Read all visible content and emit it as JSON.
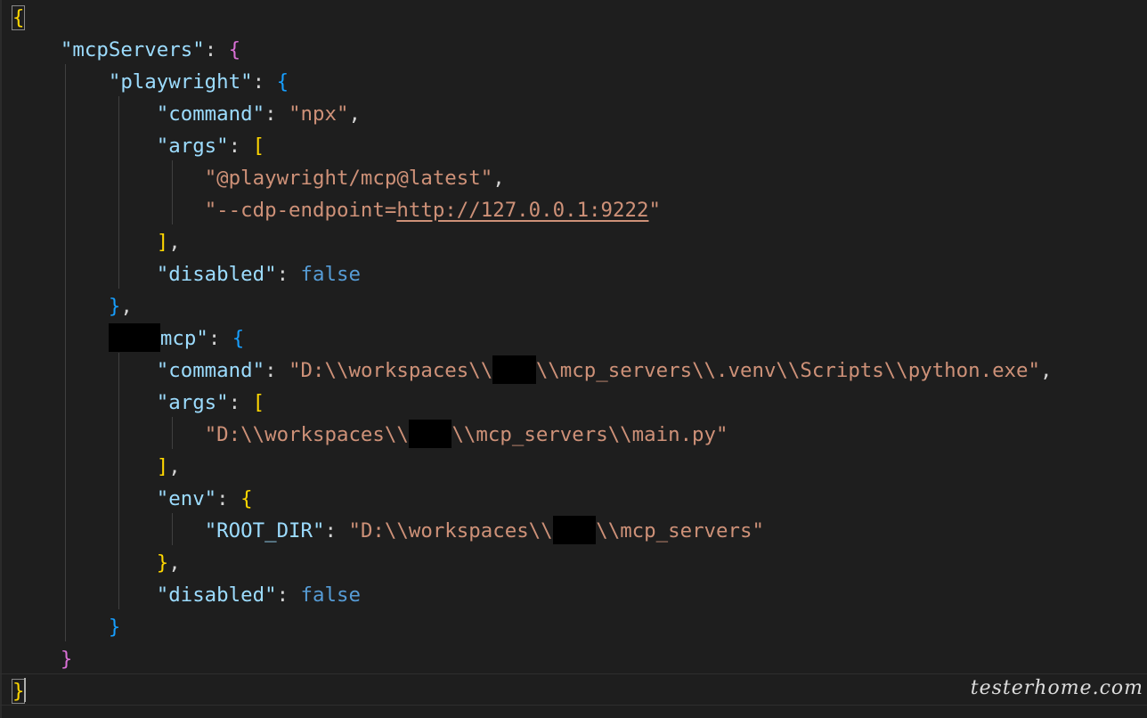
{
  "editor": {
    "lines": [
      [
        {
          "t": "{",
          "c": "b1 match-box"
        }
      ],
      [
        {
          "t": "    "
        },
        {
          "t": "\"mcpServers\"",
          "c": "key"
        },
        {
          "t": ": ",
          "c": "p"
        },
        {
          "t": "{",
          "c": "b2"
        }
      ],
      [
        {
          "t": "        "
        },
        {
          "t": "\"playwright\"",
          "c": "key"
        },
        {
          "t": ": ",
          "c": "p"
        },
        {
          "t": "{",
          "c": "b3"
        }
      ],
      [
        {
          "t": "            "
        },
        {
          "t": "\"command\"",
          "c": "key"
        },
        {
          "t": ": ",
          "c": "p"
        },
        {
          "t": "\"npx\"",
          "c": "str"
        },
        {
          "t": ",",
          "c": "p"
        }
      ],
      [
        {
          "t": "            "
        },
        {
          "t": "\"args\"",
          "c": "key"
        },
        {
          "t": ": ",
          "c": "p"
        },
        {
          "t": "[",
          "c": "b1"
        }
      ],
      [
        {
          "t": "                "
        },
        {
          "t": "\"@playwright/mcp@latest\"",
          "c": "str"
        },
        {
          "t": ",",
          "c": "p"
        }
      ],
      [
        {
          "t": "                "
        },
        {
          "t": "\"--cdp-endpoint=",
          "c": "str"
        },
        {
          "t": "http://127.0.0.1:9222",
          "c": "str link"
        },
        {
          "t": "\"",
          "c": "str"
        }
      ],
      [
        {
          "t": "            "
        },
        {
          "t": "]",
          "c": "b1"
        },
        {
          "t": ",",
          "c": "p"
        }
      ],
      [
        {
          "t": "            "
        },
        {
          "t": "\"disabled\"",
          "c": "key"
        },
        {
          "t": ": ",
          "c": "p"
        },
        {
          "t": "false",
          "c": "kw"
        }
      ],
      [
        {
          "t": "        "
        },
        {
          "t": "}",
          "c": "b3"
        },
        {
          "t": ",",
          "c": "p"
        }
      ],
      [
        {
          "t": "        "
        },
        {
          "t": "",
          "r": 4.3
        },
        {
          "t": "mcp\"",
          "c": "key"
        },
        {
          "t": ": ",
          "c": "p"
        },
        {
          "t": "{",
          "c": "b3"
        }
      ],
      [
        {
          "t": "            "
        },
        {
          "t": "\"command\"",
          "c": "key"
        },
        {
          "t": ": ",
          "c": "p"
        },
        {
          "t": "\"D:\\\\workspaces\\\\",
          "c": "str"
        },
        {
          "t": "",
          "r": 3.6
        },
        {
          "t": "\\\\mcp_servers\\\\.venv\\\\Scripts\\\\python.exe\"",
          "c": "str"
        },
        {
          "t": ",",
          "c": "p"
        }
      ],
      [
        {
          "t": "            "
        },
        {
          "t": "\"args\"",
          "c": "key"
        },
        {
          "t": ": ",
          "c": "p"
        },
        {
          "t": "[",
          "c": "b1"
        }
      ],
      [
        {
          "t": "                "
        },
        {
          "t": "\"D:\\\\workspaces\\\\",
          "c": "str"
        },
        {
          "t": "",
          "r": 3.6
        },
        {
          "t": "\\\\mcp_servers\\\\main.py\"",
          "c": "str"
        }
      ],
      [
        {
          "t": "            "
        },
        {
          "t": "]",
          "c": "b1"
        },
        {
          "t": ",",
          "c": "p"
        }
      ],
      [
        {
          "t": "            "
        },
        {
          "t": "\"env\"",
          "c": "key"
        },
        {
          "t": ": ",
          "c": "p"
        },
        {
          "t": "{",
          "c": "b1"
        }
      ],
      [
        {
          "t": "                "
        },
        {
          "t": "\"ROOT_DIR\"",
          "c": "key"
        },
        {
          "t": ": ",
          "c": "p"
        },
        {
          "t": "\"D:\\\\workspaces\\\\",
          "c": "str"
        },
        {
          "t": "",
          "r": 3.6
        },
        {
          "t": "\\\\mcp_servers\"",
          "c": "str"
        }
      ],
      [
        {
          "t": "            "
        },
        {
          "t": "}",
          "c": "b1"
        },
        {
          "t": ",",
          "c": "p"
        }
      ],
      [
        {
          "t": "            "
        },
        {
          "t": "\"disabled\"",
          "c": "key"
        },
        {
          "t": ": ",
          "c": "p"
        },
        {
          "t": "false",
          "c": "kw"
        }
      ],
      [
        {
          "t": "        "
        },
        {
          "t": "}",
          "c": "b3"
        }
      ],
      [
        {
          "t": "    "
        },
        {
          "t": "}",
          "c": "b2"
        }
      ],
      [
        {
          "t": "}",
          "c": "b1 match-box"
        }
      ]
    ]
  },
  "watermark": "testerhome.com",
  "colors": {
    "background": "#1e1e1e",
    "key": "#9cdcfe",
    "string": "#ce9178",
    "keyword": "#569cd6",
    "bracket_level1": "#ffd700",
    "bracket_level2": "#da70d6",
    "bracket_level3": "#179fff"
  }
}
